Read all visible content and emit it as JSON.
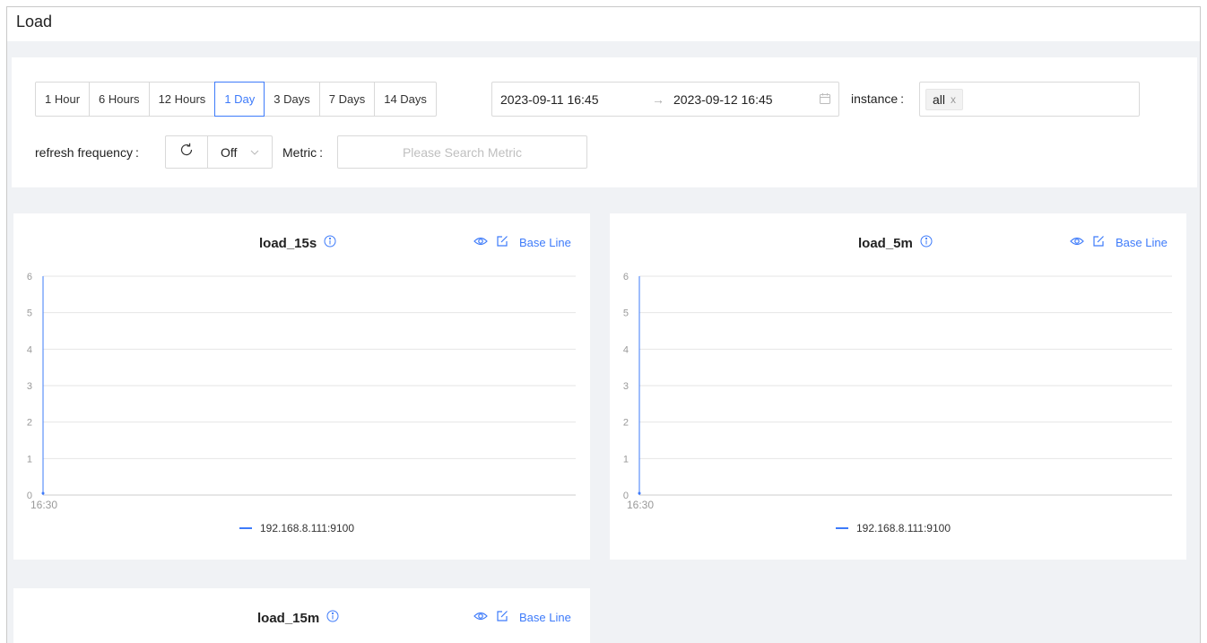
{
  "page": {
    "title": "Load"
  },
  "time_ranges": [
    {
      "label": "1 Hour",
      "active": false
    },
    {
      "label": "6 Hours",
      "active": false
    },
    {
      "label": "12 Hours",
      "active": false
    },
    {
      "label": "1 Day",
      "active": true
    },
    {
      "label": "3 Days",
      "active": false
    },
    {
      "label": "7 Days",
      "active": false
    },
    {
      "label": "14 Days",
      "active": false
    }
  ],
  "date_range": {
    "start": "2023-09-11 16:45",
    "arrow": "→",
    "end": "2023-09-12 16:45"
  },
  "instance": {
    "label": "instance",
    "tags": [
      "all"
    ],
    "tag_close": "x"
  },
  "refresh": {
    "label": "refresh frequency",
    "value": "Off"
  },
  "metric": {
    "label": "Metric",
    "placeholder": "Please Search Metric"
  },
  "colon": ":",
  "actions": {
    "baseline_label": "Base Line"
  },
  "colors": {
    "accent": "#3e7bfa",
    "grid": "#e6e6e6",
    "axis": "#cccccc",
    "background": "#f0f2f5"
  },
  "charts": [
    {
      "title": "load_15s",
      "legend": "192.168.8.111:9100"
    },
    {
      "title": "load_5m",
      "legend": "192.168.8.111:9100"
    },
    {
      "title": "load_15m",
      "legend": ""
    }
  ],
  "chart_data": [
    {
      "type": "line",
      "title": "load_15s",
      "x_ticks": [
        "16:30"
      ],
      "y_ticks": [
        0,
        1,
        2,
        3,
        4,
        5,
        6
      ],
      "ylim": [
        0,
        6
      ],
      "grid": true,
      "legend_position": "bottom",
      "series": [
        {
          "name": "192.168.8.111:9100",
          "color": "#3e7bfa",
          "points": [
            {
              "x": "16:30",
              "y": 0.05
            }
          ]
        }
      ]
    },
    {
      "type": "line",
      "title": "load_5m",
      "x_ticks": [
        "16:30"
      ],
      "y_ticks": [
        0,
        1,
        2,
        3,
        4,
        5,
        6
      ],
      "ylim": [
        0,
        6
      ],
      "grid": true,
      "legend_position": "bottom",
      "series": [
        {
          "name": "192.168.8.111:9100",
          "color": "#3e7bfa",
          "points": [
            {
              "x": "16:30",
              "y": 0.05
            }
          ]
        }
      ]
    },
    {
      "type": "line",
      "title": "load_15m",
      "x_ticks": [],
      "y_ticks": [],
      "grid": true,
      "series": []
    }
  ]
}
